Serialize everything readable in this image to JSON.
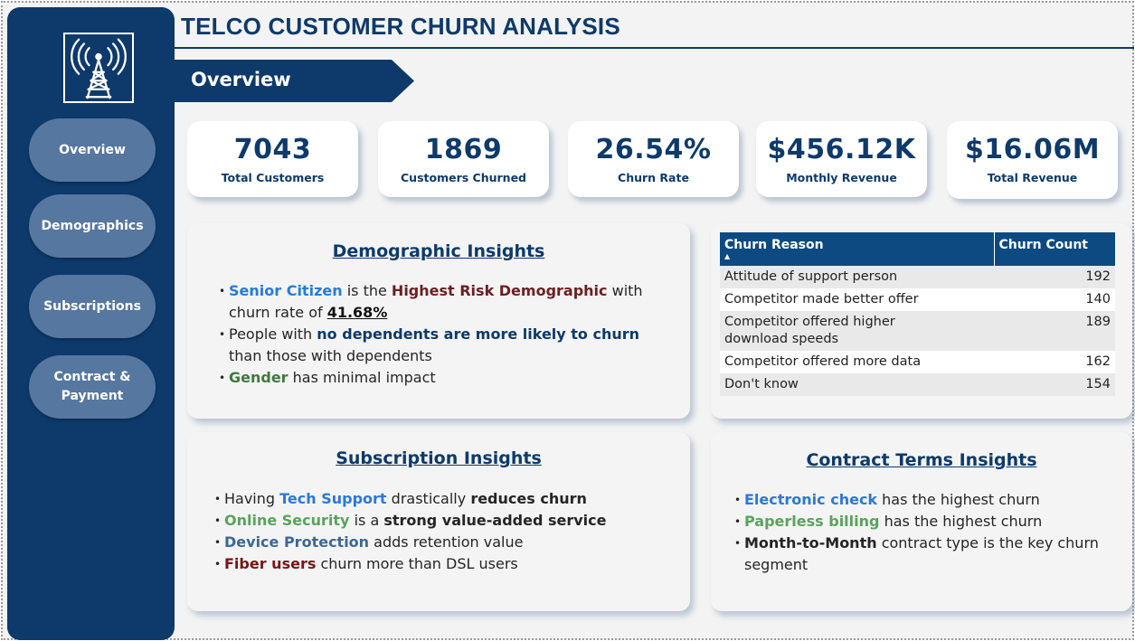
{
  "title": "TELCO CUSTOMER CHURN ANALYSIS",
  "section": "Overview",
  "sidebar": {
    "logo_icon": "radio-tower-icon",
    "nav": [
      "Overview",
      "Demographics",
      "Subscriptions",
      "Contract & Payment"
    ]
  },
  "kpis": [
    {
      "value": "7043",
      "label": "Total Customers"
    },
    {
      "value": "1869",
      "label": "Customers Churned"
    },
    {
      "value": "26.54%",
      "label": "Churn Rate"
    },
    {
      "value": "$456.12K",
      "label": "Monthly Revenue"
    },
    {
      "value": "$16.06M",
      "label": "Total Revenue"
    }
  ],
  "demographic": {
    "heading": "Demographic Insights",
    "b1": {
      "p1": "Senior Citizen",
      "p2": " is the ",
      "p3": "Highest Risk Demographic",
      "p4": " with churn rate of ",
      "p5": "41.68%"
    },
    "b2": {
      "p1": "People with ",
      "p2": "no dependents are more likely to churn",
      "p3": " than those with dependents"
    },
    "b3": {
      "p1": "Gender",
      "p2": " has minimal impact"
    }
  },
  "churn_table": {
    "headers": [
      "Churn Reason",
      "Churn Count"
    ],
    "rows": [
      {
        "reason": "Attitude of support person",
        "count": "192"
      },
      {
        "reason": "Competitor made better offer",
        "count": "140"
      },
      {
        "reason": "Competitor offered higher download speeds",
        "count": "189"
      },
      {
        "reason": "Competitor offered more data",
        "count": "162"
      },
      {
        "reason": "Don't know",
        "count": "154"
      }
    ]
  },
  "subscription": {
    "heading": "Subscription Insights",
    "b1": {
      "p1": "Having ",
      "p2": "Tech Support",
      "p3": " drastically ",
      "p4": "reduces churn"
    },
    "b2": {
      "p1": "Online Security",
      "p2": " is a ",
      "p3": "strong value-added service"
    },
    "b3": {
      "p1": "Device Protection",
      "p2": " adds retention value"
    },
    "b4": {
      "p1": "Fiber users",
      "p2": " churn more than DSL users"
    }
  },
  "contract": {
    "heading": "Contract Terms Insights",
    "b1": {
      "p1": "Electronic check",
      "p2": " has the highest churn"
    },
    "b2": {
      "p1": "Paperless billing",
      "p2": " has the highest churn"
    },
    "b3": {
      "p1": "Month-to-Month",
      "p2": " contract type is the key churn segment"
    }
  },
  "colors": {
    "navy": "#0e3a6b",
    "sidebar": "#0d3a6b",
    "nav_button": "#5677a0",
    "table_header": "#0e4a82"
  }
}
